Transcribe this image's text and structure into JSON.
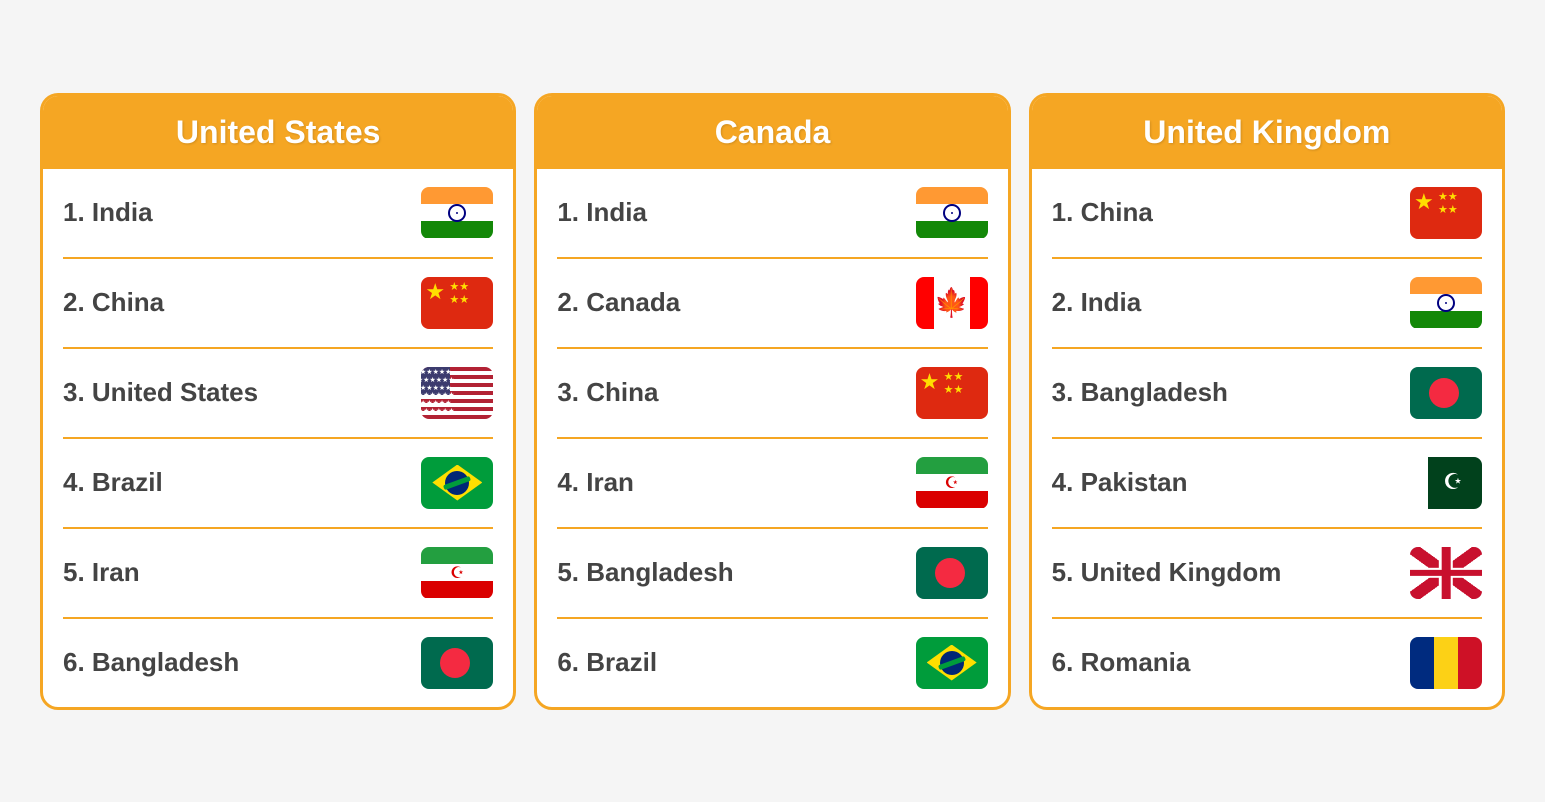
{
  "cards": [
    {
      "id": "usa-card",
      "header": "United States",
      "items": [
        {
          "rank": "1. India",
          "flag": "india"
        },
        {
          "rank": "2. China",
          "flag": "china"
        },
        {
          "rank": "3. United States",
          "flag": "usa"
        },
        {
          "rank": "4. Brazil",
          "flag": "brazil"
        },
        {
          "rank": "5. Iran",
          "flag": "iran"
        },
        {
          "rank": "6. Bangladesh",
          "flag": "bangladesh"
        }
      ]
    },
    {
      "id": "canada-card",
      "header": "Canada",
      "items": [
        {
          "rank": "1. India",
          "flag": "india"
        },
        {
          "rank": "2. Canada",
          "flag": "canada"
        },
        {
          "rank": "3. China",
          "flag": "china"
        },
        {
          "rank": "4. Iran",
          "flag": "iran"
        },
        {
          "rank": "5. Bangladesh",
          "flag": "bangladesh"
        },
        {
          "rank": "6. Brazil",
          "flag": "brazil"
        }
      ]
    },
    {
      "id": "uk-card",
      "header": "United Kingdom",
      "items": [
        {
          "rank": "1. China",
          "flag": "china"
        },
        {
          "rank": "2. India",
          "flag": "india"
        },
        {
          "rank": "3. Bangladesh",
          "flag": "bangladesh"
        },
        {
          "rank": "4. Pakistan",
          "flag": "pakistan"
        },
        {
          "rank": "5. United Kingdom",
          "flag": "uk"
        },
        {
          "rank": "6. Romania",
          "flag": "romania"
        }
      ]
    }
  ]
}
